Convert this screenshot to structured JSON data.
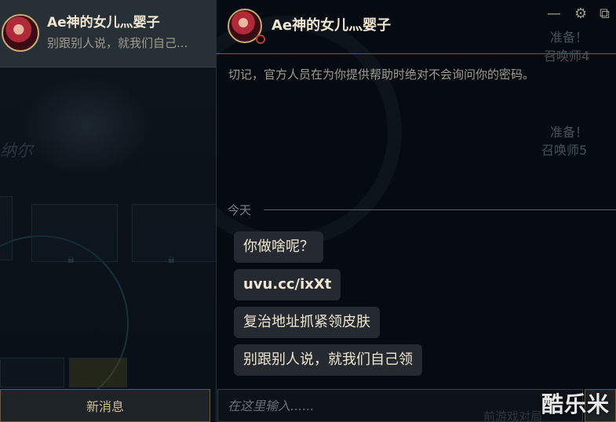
{
  "contact": {
    "name": "Ae神的女儿灬婴子",
    "last_message": "别跟别人说，就我们自己..."
  },
  "left_panel": {
    "faded_name": "纳尔",
    "new_message_button": "新消息"
  },
  "chat": {
    "title": "Ae神的女儿灬婴子",
    "window_controls": [
      "—",
      "⚙",
      "⧉"
    ],
    "faded_status": [
      "准备！",
      "召唤师4",
      "准备！",
      "召唤师5"
    ],
    "security_warning": "切记，官方人员在为你提供帮助时绝对不会询问你的密码。",
    "date_separator": "今天",
    "messages": [
      {
        "text": "你做啥呢？"
      },
      {
        "text": "uvu.cc/ixXt"
      },
      {
        "text": "复治地址抓紧领皮肤"
      },
      {
        "text": "别跟别人说，就我们自己领"
      }
    ],
    "input_placeholder": "在这里输入......",
    "input_faded_text": "前游戏对局"
  },
  "watermark": "酷乐米",
  "colors": {
    "gold_border": "#785a28",
    "status_busy": "#c0392b",
    "text_primary": "#f0e6d2",
    "text_secondary": "#a09b8c"
  }
}
